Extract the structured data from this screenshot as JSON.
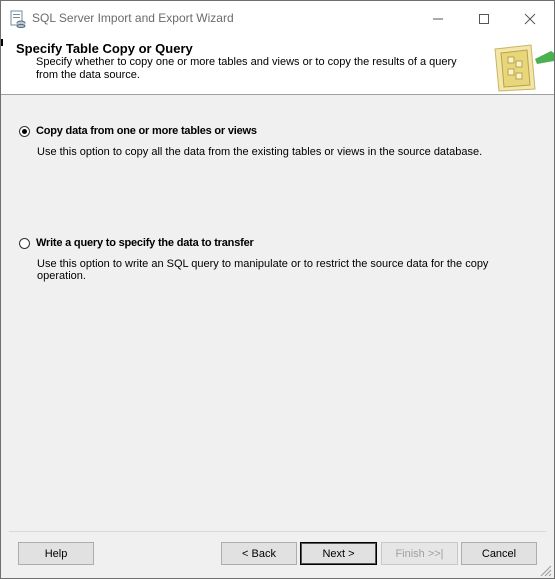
{
  "window": {
    "title": "SQL Server Import and Export Wizard"
  },
  "header": {
    "title": "Specify Table Copy or Query",
    "description": "Specify whether to copy one or more tables and views or to copy the results of a query from the data source."
  },
  "options": [
    {
      "label": "Copy data from one or more tables or views",
      "description": "Use this option to copy all the data from the existing tables or views in the source database.",
      "selected": true
    },
    {
      "label": "Write a query to specify the data to transfer",
      "description": "Use this option to write an SQL query to manipulate or to restrict the source data for the copy operation.",
      "selected": false
    }
  ],
  "buttons": {
    "help": "Help",
    "back": "< Back",
    "next": "Next >",
    "finish": "Finish >>|",
    "cancel": "Cancel"
  },
  "colors": {
    "accent_green": "#4caf50",
    "folder_yellow": "#e8d77a"
  }
}
